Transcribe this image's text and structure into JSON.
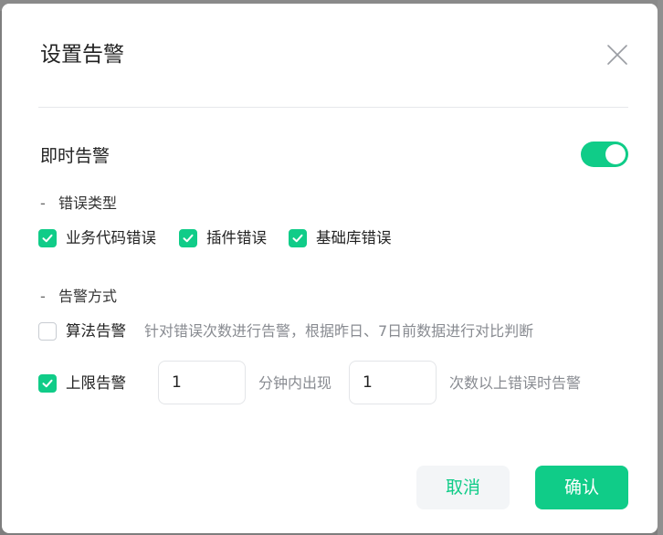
{
  "dialog": {
    "title": "设置告警",
    "close_icon": "close-icon"
  },
  "instant_alert": {
    "label": "即时告警",
    "enabled": true
  },
  "error_types": {
    "heading": "错误类型",
    "options": [
      {
        "label": "业务代码错误",
        "checked": true
      },
      {
        "label": "插件错误",
        "checked": true
      },
      {
        "label": "基础库错误",
        "checked": true
      }
    ]
  },
  "alert_methods": {
    "heading": "告警方式",
    "algorithm": {
      "label": "算法告警",
      "checked": false,
      "hint": "针对错误次数进行告警，根据昨日、7日前数据进行对比判断"
    },
    "upper_limit": {
      "label": "上限告警",
      "checked": true,
      "minutes_value": "1",
      "minutes_suffix": "分钟内出现",
      "count_value": "1",
      "count_suffix": "次数以上错误时告警"
    }
  },
  "buttons": {
    "cancel": "取消",
    "confirm": "确认"
  },
  "colors": {
    "accent": "#10cc88",
    "backdrop": "#7e7e7e"
  }
}
